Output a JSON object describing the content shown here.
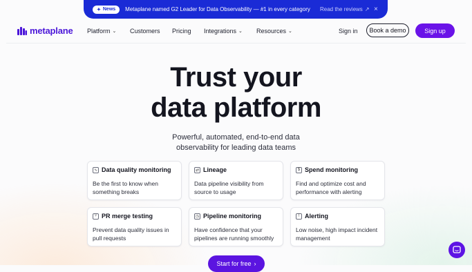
{
  "banner": {
    "badge_label": "News",
    "text": "Metaplane named G2 Leader for Data Observability — #1 in every category",
    "link_label": "Read the reviews",
    "close_icon": "×"
  },
  "nav": {
    "brand": "metaplane",
    "menu": [
      {
        "label": "Platform",
        "dropdown": true
      },
      {
        "label": "Customers",
        "dropdown": false
      },
      {
        "label": "Pricing",
        "dropdown": false
      },
      {
        "label": "Integrations",
        "dropdown": true
      },
      {
        "label": "Resources",
        "dropdown": true
      }
    ],
    "signin_label": "Sign in",
    "demo_label": "Book a demo",
    "signup_label": "Sign up"
  },
  "hero": {
    "title_line1": "Trust your",
    "title_line2": "data platform",
    "subtitle_line1": "Powerful, automated, end-to-end data",
    "subtitle_line2": "observability for leading data teams"
  },
  "features": [
    {
      "title": "Data quality monitoring",
      "desc_line1": "Be the first to know when",
      "desc_line2": "something breaks",
      "icon": "anomaly-icon"
    },
    {
      "title": "Lineage",
      "desc_line1": "Data pipeline visibility from",
      "desc_line2": "source to usage",
      "icon": "lineage-icon"
    },
    {
      "title": "Spend monitoring",
      "desc_line1": "Find and optimize cost and",
      "desc_line2": "performance with alerting",
      "icon": "spend-icon"
    },
    {
      "title": "PR merge testing",
      "desc_line1": "Prevent data quality issues in",
      "desc_line2": "pull requests",
      "icon": "merge-icon"
    },
    {
      "title": "Pipeline monitoring",
      "desc_line1": "Have confidence that your",
      "desc_line2": "pipelines are running smoothly",
      "icon": "pipeline-icon"
    },
    {
      "title": "Alerting",
      "desc_line1": "Low noise, high impact incident",
      "desc_line2": "management",
      "icon": "alert-icon"
    }
  ],
  "cta": {
    "label": "Start for free"
  },
  "colors": {
    "brand": "#6a13e8",
    "banner": "#1a2bd6"
  }
}
